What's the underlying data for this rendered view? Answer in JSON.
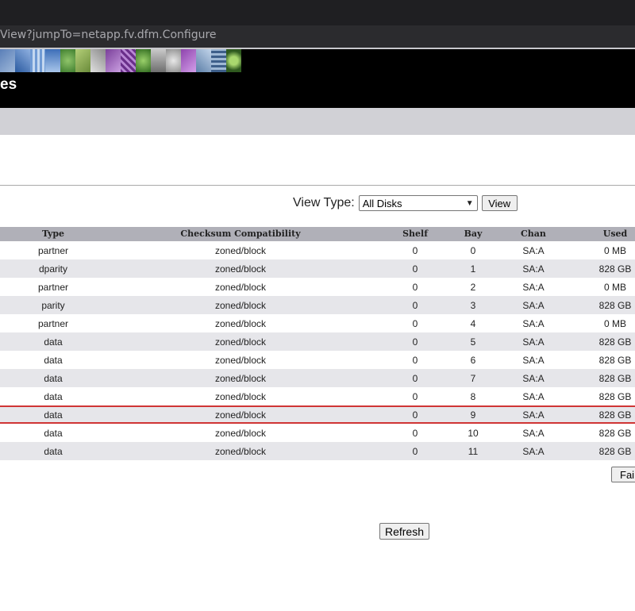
{
  "browser": {
    "address": "View?jumpTo=netapp.fv.dfm.Configure"
  },
  "header": {
    "title": "es"
  },
  "controls": {
    "view_type_label": "View Type:",
    "view_type_selected": "All Disks",
    "view_button": "View",
    "fail_button": "Fai",
    "refresh_button": "Refresh"
  },
  "table": {
    "columns": {
      "type": "Type",
      "checksum": "Checksum Compatibility",
      "shelf": "Shelf",
      "bay": "Bay",
      "chan": "Chan",
      "used": "Used"
    },
    "rows": [
      {
        "type": "partner",
        "checksum": "zoned/block",
        "shelf": "0",
        "bay": "0",
        "chan": "SA:A",
        "used": "0 MB"
      },
      {
        "type": "dparity",
        "checksum": "zoned/block",
        "shelf": "0",
        "bay": "1",
        "chan": "SA:A",
        "used": "828 GB"
      },
      {
        "type": "partner",
        "checksum": "zoned/block",
        "shelf": "0",
        "bay": "2",
        "chan": "SA:A",
        "used": "0 MB"
      },
      {
        "type": "parity",
        "checksum": "zoned/block",
        "shelf": "0",
        "bay": "3",
        "chan": "SA:A",
        "used": "828 GB"
      },
      {
        "type": "partner",
        "checksum": "zoned/block",
        "shelf": "0",
        "bay": "4",
        "chan": "SA:A",
        "used": "0 MB"
      },
      {
        "type": "data",
        "checksum": "zoned/block",
        "shelf": "0",
        "bay": "5",
        "chan": "SA:A",
        "used": "828 GB"
      },
      {
        "type": "data",
        "checksum": "zoned/block",
        "shelf": "0",
        "bay": "6",
        "chan": "SA:A",
        "used": "828 GB"
      },
      {
        "type": "data",
        "checksum": "zoned/block",
        "shelf": "0",
        "bay": "7",
        "chan": "SA:A",
        "used": "828 GB"
      },
      {
        "type": "data",
        "checksum": "zoned/block",
        "shelf": "0",
        "bay": "8",
        "chan": "SA:A",
        "used": "828 GB"
      },
      {
        "type": "data",
        "checksum": "zoned/block",
        "shelf": "0",
        "bay": "9",
        "chan": "SA:A",
        "used": "828 GB"
      },
      {
        "type": "data",
        "checksum": "zoned/block",
        "shelf": "0",
        "bay": "10",
        "chan": "SA:A",
        "used": "828 GB"
      },
      {
        "type": "data",
        "checksum": "zoned/block",
        "shelf": "0",
        "bay": "11",
        "chan": "SA:A",
        "used": "828 GB"
      }
    ],
    "highlighted_row_bay": "9"
  },
  "colors": {
    "header_bg": "#000000",
    "grey_bar": "#d1d1d6",
    "table_header": "#b0b0b8",
    "row_alt": "#e6e6ea",
    "highlight_border": "#d03535"
  }
}
